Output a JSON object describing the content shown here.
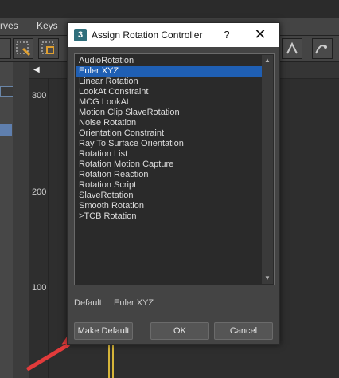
{
  "background_app": {
    "menu": [
      "rves",
      "Keys"
    ],
    "y_labels": [
      "300",
      "200",
      "100"
    ]
  },
  "dialog": {
    "icon_label": "3",
    "title": "Assign Rotation Controller",
    "help_label": "?",
    "close_label": "✕",
    "items": [
      "AudioRotation",
      "Euler XYZ",
      "Linear Rotation",
      "LookAt Constraint",
      "MCG LookAt",
      "Motion Clip SlaveRotation",
      "Noise Rotation",
      "Orientation Constraint",
      "Ray To Surface Orientation",
      "Rotation List",
      "Rotation Motion Capture",
      "Rotation Reaction",
      "Rotation Script",
      "SlaveRotation",
      "Smooth Rotation",
      ">TCB Rotation"
    ],
    "selected_item": "Euler XYZ",
    "default_label": "Default:",
    "default_value": "Euler XYZ",
    "buttons": {
      "make_default": "Make Default",
      "ok": "OK",
      "cancel": "Cancel"
    }
  },
  "colors": {
    "selection": "#1f5fb4",
    "annotation_arrow": "#e23b3b",
    "key_line": "#d6b53a"
  }
}
